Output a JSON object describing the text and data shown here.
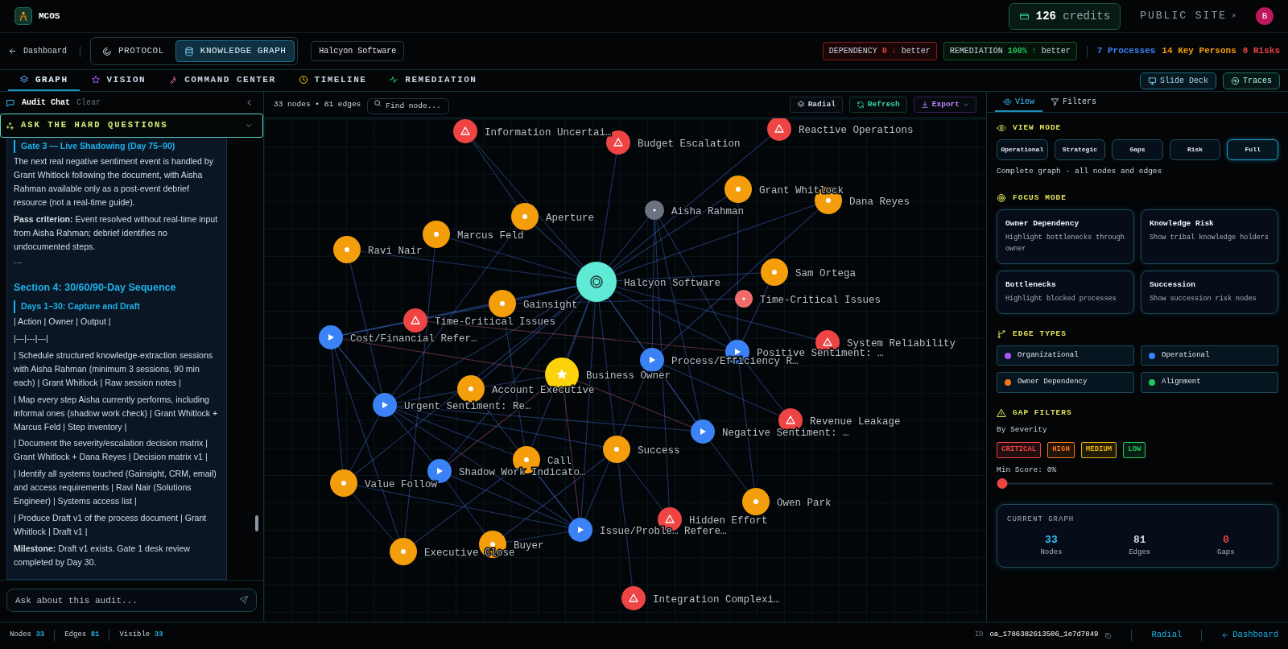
{
  "app": {
    "name": "MCOS",
    "credits": "126",
    "credits_label": "credits",
    "public_site": "PUBLIC SITE",
    "avatar": "B"
  },
  "breadcrumb": {
    "back": "Dashboard"
  },
  "mode_tabs": [
    {
      "label": "PROTOCOL",
      "selected": false
    },
    {
      "label": "KNOWLEDGE GRAPH",
      "selected": true
    }
  ],
  "client": "Halcyon Software",
  "metrics": [
    {
      "kind": "dependency",
      "label": "DEPENDENCY",
      "value": "0 ↓",
      "suffix": "better"
    },
    {
      "kind": "remediation",
      "label": "REMEDIATION",
      "value": "100% ↑",
      "suffix": "better"
    }
  ],
  "counts": [
    {
      "text": "7 Processes",
      "color": "#3b82f6"
    },
    {
      "text": "14 Key Persons",
      "color": "#f59e0b"
    },
    {
      "text": "8 Risks",
      "color": "#ef4444"
    }
  ],
  "nav_tabs": [
    {
      "label": "GRAPH",
      "selected": true
    },
    {
      "label": "VISION",
      "selected": false
    },
    {
      "label": "COMMAND CENTER",
      "selected": false
    },
    {
      "label": "TIMELINE",
      "selected": false
    },
    {
      "label": "REMEDIATION",
      "selected": false
    }
  ],
  "nav_actions": [
    "Slide Deck",
    "Traces"
  ],
  "chat": {
    "title": "Audit Chat",
    "clear": "Clear",
    "banner": "ASK THE HARD QUESTIONS",
    "blocks": [
      {
        "kind": "subheading",
        "text": "Gate 3 — Live Shadowing (Day 75–90)"
      },
      {
        "kind": "paragraph",
        "text": "The next real negative sentiment event is handled by Grant Whitlock following the document, with Aisha Rahman available only as a post-event debrief resource (not a real-time guide)."
      },
      {
        "kind": "paragraph",
        "text": "**Pass criterion:** Event resolved without real-time input from Aisha Rahman; debrief identifies no undocumented steps."
      },
      {
        "kind": "rule",
        "text": "---"
      },
      {
        "kind": "heading",
        "text": "Section 4: 30/60/90-Day Sequence"
      },
      {
        "kind": "subheading",
        "text": "Days 1–30: Capture and Draft"
      },
      {
        "kind": "paragraph",
        "text": "| Action | Owner | Output |"
      },
      {
        "kind": "paragraph",
        "text": "|---|---|---|"
      },
      {
        "kind": "paragraph",
        "text": "| Schedule structured knowledge-extraction sessions with Aisha Rahman (minimum 3 sessions, 90 min each) | Grant Whitlock | Raw session notes |"
      },
      {
        "kind": "paragraph",
        "text": "| Map every step Aisha currently performs, including informal ones (shadow work check) | Grant Whitlock + Marcus Feld | Step inventory |"
      },
      {
        "kind": "paragraph",
        "text": "| Document the severity/escalation decision matrix | Grant Whitlock + Dana Reyes | Decision matrix v1 |"
      },
      {
        "kind": "paragraph",
        "text": "| Identify all systems touched (Gainsight, CRM, email) and access requirements | Ravi Nair (Solutions Engineer) | Systems access list |"
      },
      {
        "kind": "paragraph",
        "text": "| Produce Draft v1 of the process document | Grant Whitlock | Draft v1 |"
      },
      {
        "kind": "paragraph",
        "text": "**Milestone:** Draft v1 exists. Gate 1 desk review completed by Day 30."
      }
    ],
    "input": {
      "placeholder": "Ask about this audit..."
    }
  },
  "graph": {
    "summary": "33 nodes • 81 edges",
    "search": {
      "placeholder": "Find node..."
    },
    "actions": [
      {
        "kind": "layout",
        "label": "Radial"
      },
      {
        "kind": "refresh",
        "label": "Refresh"
      },
      {
        "kind": "export",
        "label": "Export"
      }
    ],
    "nodes": [
      {
        "label": "Information Uncertai…",
        "kind": "gap"
      },
      {
        "label": "Budget Escalation",
        "kind": "gap"
      },
      {
        "label": "Reactive Operations",
        "kind": "gap"
      },
      {
        "label": "Grant Whitlock",
        "kind": "person"
      },
      {
        "label": "Dana Reyes",
        "kind": "person"
      },
      {
        "label": "Aperture",
        "kind": "person"
      },
      {
        "label": "Aisha Rahman",
        "kind": "expert"
      },
      {
        "label": "Marcus Feld",
        "kind": "person"
      },
      {
        "label": "Ravi Nair",
        "kind": "person"
      },
      {
        "label": "Halcyon Software",
        "kind": "company"
      },
      {
        "label": "Sam Ortega",
        "kind": "person"
      },
      {
        "label": "Time-Critical Issues",
        "kind": "signal"
      },
      {
        "label": "Gainsight",
        "kind": "person"
      },
      {
        "label": "Time-Critical Issues",
        "kind": "gap"
      },
      {
        "label": "Cost/Financial Refer…",
        "kind": "process"
      },
      {
        "label": "System Reliability",
        "kind": "gap"
      },
      {
        "label": "Positive Sentiment: …",
        "kind": "process"
      },
      {
        "label": "Process/Efficiency R…",
        "kind": "process"
      },
      {
        "label": "Business Owner",
        "kind": "owner"
      },
      {
        "label": "Account Executive",
        "kind": "person"
      },
      {
        "label": "Urgent Sentiment: Re…",
        "kind": "process"
      },
      {
        "label": "Revenue Leakage",
        "kind": "gap"
      },
      {
        "label": "Negative Sentiment: …",
        "kind": "process"
      },
      {
        "label": "Success",
        "kind": "person"
      },
      {
        "label": "Call",
        "kind": "person"
      },
      {
        "label": "Shadow Work Indicato…",
        "kind": "process"
      },
      {
        "label": "Value Follow",
        "kind": "person"
      },
      {
        "label": "Owen Park",
        "kind": "person"
      },
      {
        "label": "Hidden Effort",
        "kind": "gap"
      },
      {
        "label": "Issue/Proble… Refere…",
        "kind": "process"
      },
      {
        "label": "Buyer",
        "kind": "person"
      },
      {
        "label": "Executive Close",
        "kind": "person"
      },
      {
        "label": "Integration Complexi…",
        "kind": "gap"
      }
    ]
  },
  "panel": {
    "tabs": [
      {
        "label": "View",
        "selected": true
      },
      {
        "label": "Filters",
        "selected": false
      }
    ],
    "view_mode": {
      "title": "VIEW MODE",
      "options": [
        {
          "label": "Operational",
          "selected": false
        },
        {
          "label": "Strategic",
          "selected": false
        },
        {
          "label": "Gaps",
          "selected": false
        },
        {
          "label": "Risk",
          "selected": false
        },
        {
          "label": "Full",
          "selected": true
        }
      ],
      "description": "Complete graph - all nodes and edges"
    },
    "focus_mode": {
      "title": "FOCUS MODE",
      "cards": [
        {
          "title": "Owner Dependency",
          "description": "Highlight bottlenecks through owner"
        },
        {
          "title": "Knowledge Risk",
          "description": "Show tribal knowledge holders"
        },
        {
          "title": "Bottlenecks",
          "description": "Highlight blocked processes"
        },
        {
          "title": "Succession",
          "description": "Show succession risk nodes"
        }
      ]
    },
    "edge_types": {
      "title": "EDGE TYPES",
      "items": [
        {
          "label": "Organizational",
          "color": "#a855f7"
        },
        {
          "label": "Operational",
          "color": "#3b82f6"
        },
        {
          "label": "Owner Dependency",
          "color": "#f97316"
        },
        {
          "label": "Alignment",
          "color": "#22c55e"
        }
      ]
    },
    "gap_filters": {
      "title": "GAP FILTERS",
      "subtitle": "By Severity",
      "severities": [
        {
          "label": "CRITICAL",
          "color": "#ef4444"
        },
        {
          "label": "HIGH",
          "color": "#f97316"
        },
        {
          "label": "MEDIUM",
          "color": "#eab308"
        },
        {
          "label": "LOW",
          "color": "#22c55e"
        }
      ],
      "min_score": "Min Score: 0%",
      "slider": {
        "level": 0
      }
    },
    "current_graph": {
      "title": "CURRENT GRAPH",
      "stats": [
        {
          "value": "33",
          "label": "Nodes",
          "color": "#38bdf8"
        },
        {
          "value": "81",
          "label": "Edges",
          "color": "#cbd5e1"
        },
        {
          "value": "0",
          "label": "Gaps",
          "color": "#ef4444"
        }
      ]
    }
  },
  "status_bar": {
    "stats": [
      {
        "label": "Nodes",
        "value": "33"
      },
      {
        "label": "Edges",
        "value": "81"
      },
      {
        "label": "Visible",
        "value": "33"
      }
    ],
    "id_label": "ID",
    "id": "oa_1786382613506_1e7d7849",
    "links": [
      "Radial",
      "Dashboard"
    ]
  }
}
